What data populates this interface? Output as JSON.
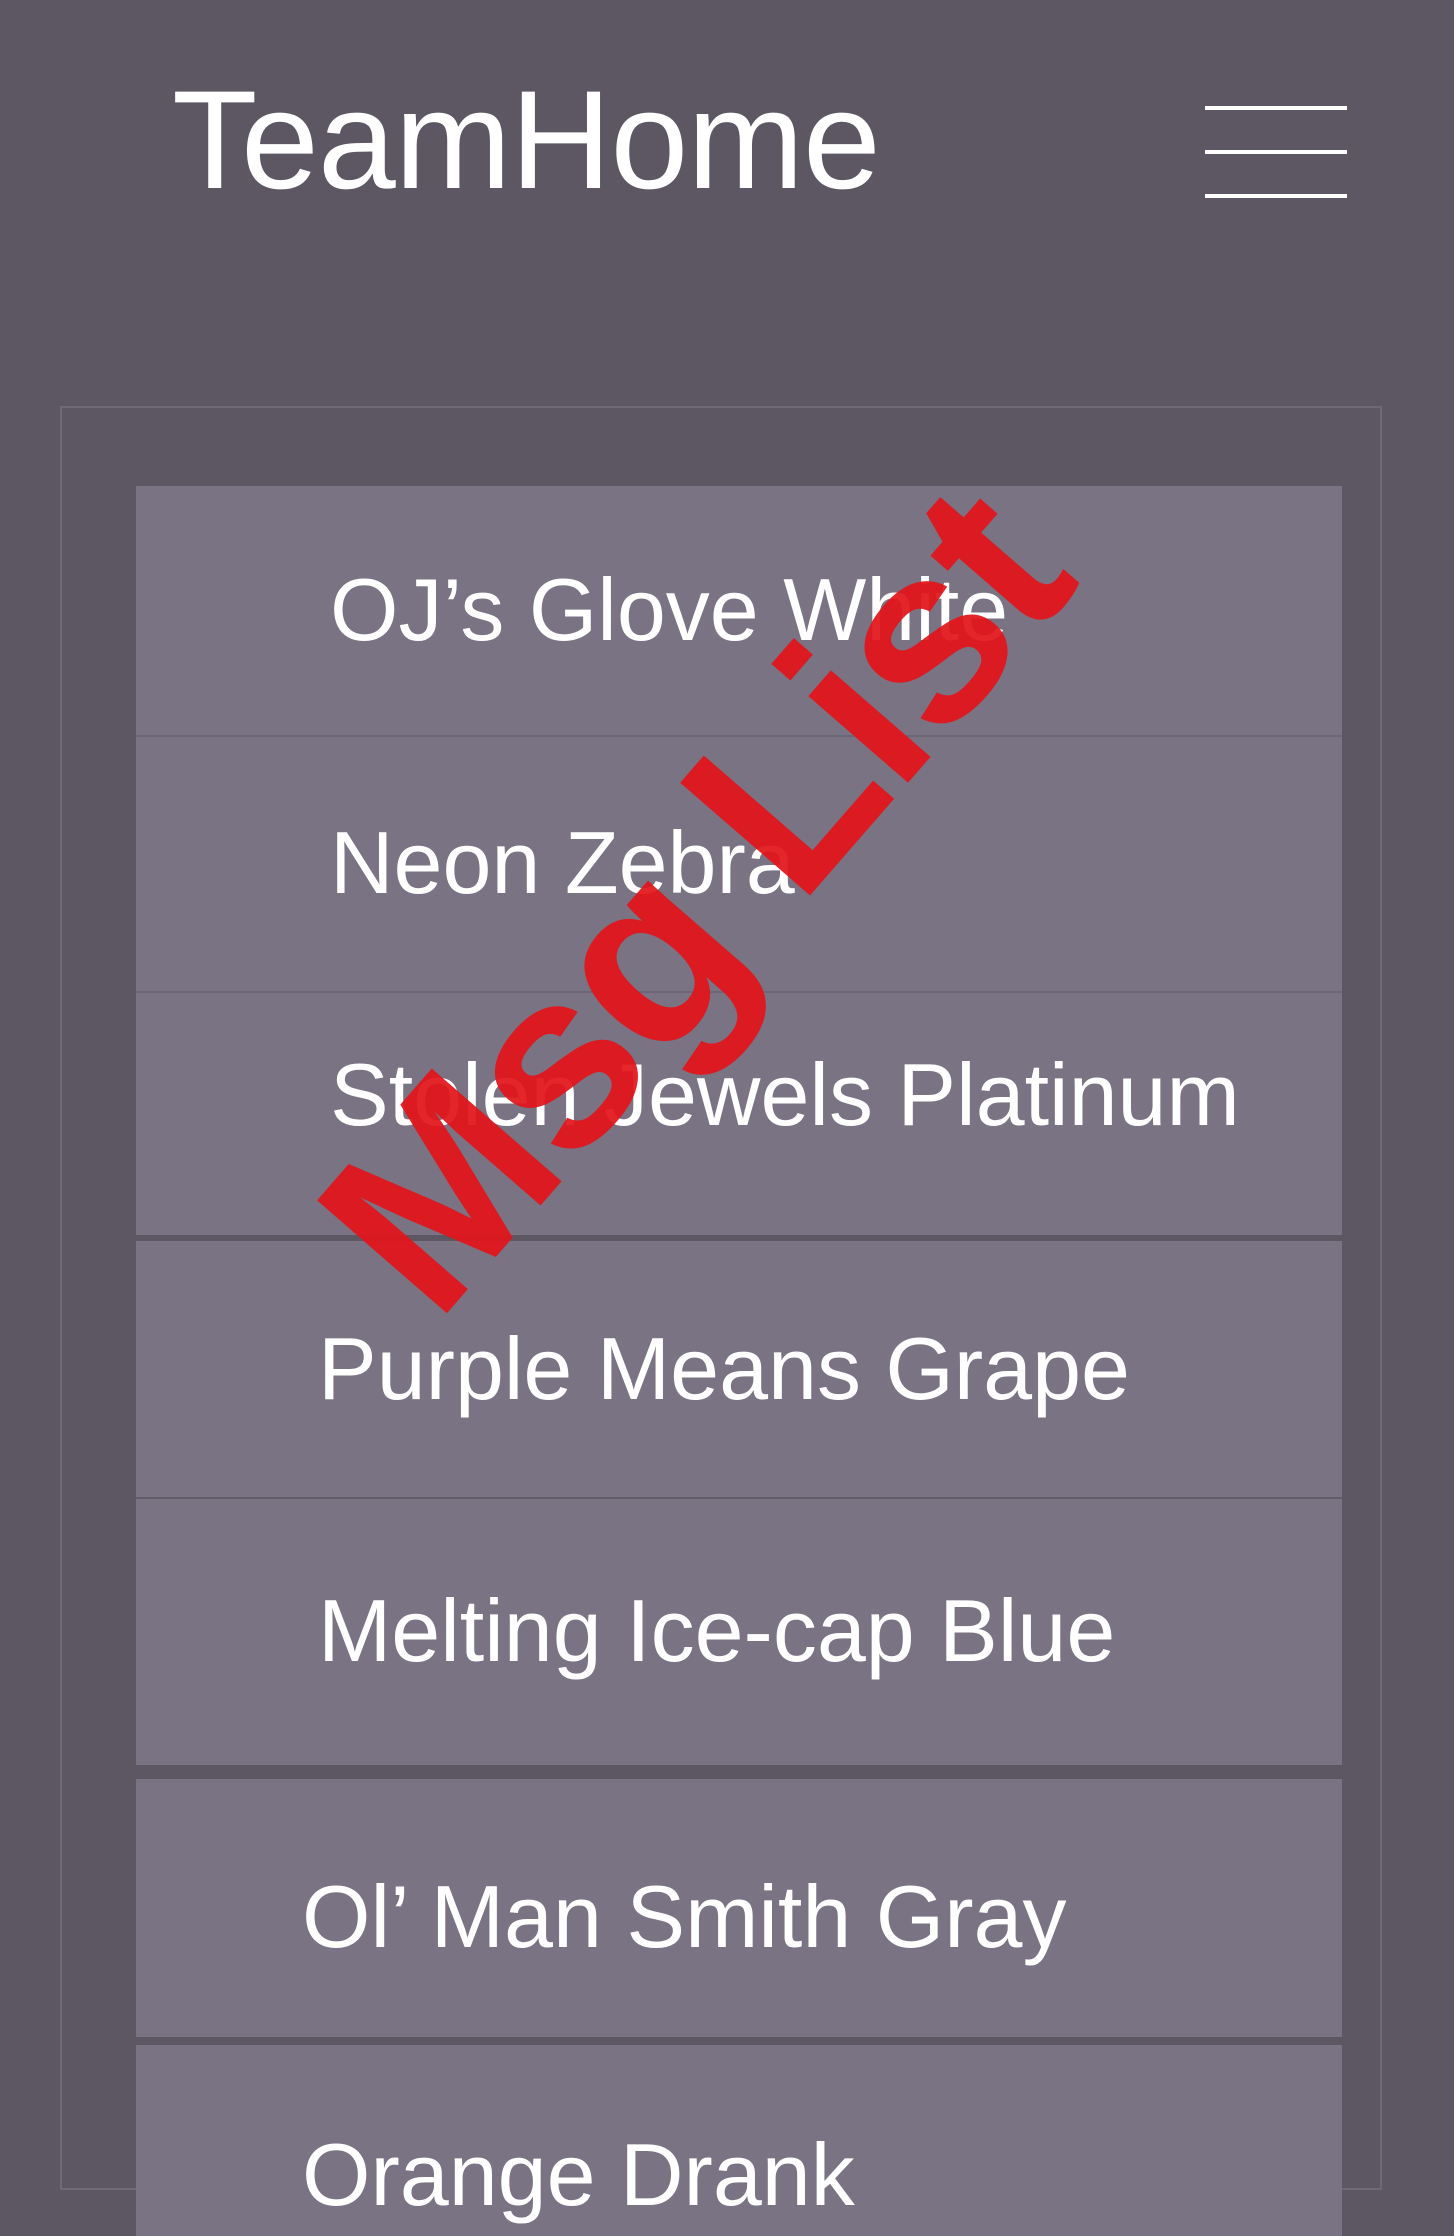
{
  "header": {
    "title": "TeamHome",
    "menu_icon": "hamburger-menu-icon"
  },
  "colors": {
    "background": "#5c5762",
    "list_item": "#7a7383",
    "text": "#ffffff",
    "stamp": "#e2141a"
  },
  "list": {
    "items": [
      {
        "label": "OJ’s Glove White"
      },
      {
        "label": "Neon Zebra"
      },
      {
        "label": "Stolen Jewels Platinum"
      },
      {
        "label": "Purple Means Grape"
      },
      {
        "label": "Melting Ice-cap Blue"
      },
      {
        "label": "Ol’ Man Smith Gray"
      },
      {
        "label": "Orange Drank"
      }
    ]
  },
  "stamp": {
    "text": "Msg List"
  }
}
